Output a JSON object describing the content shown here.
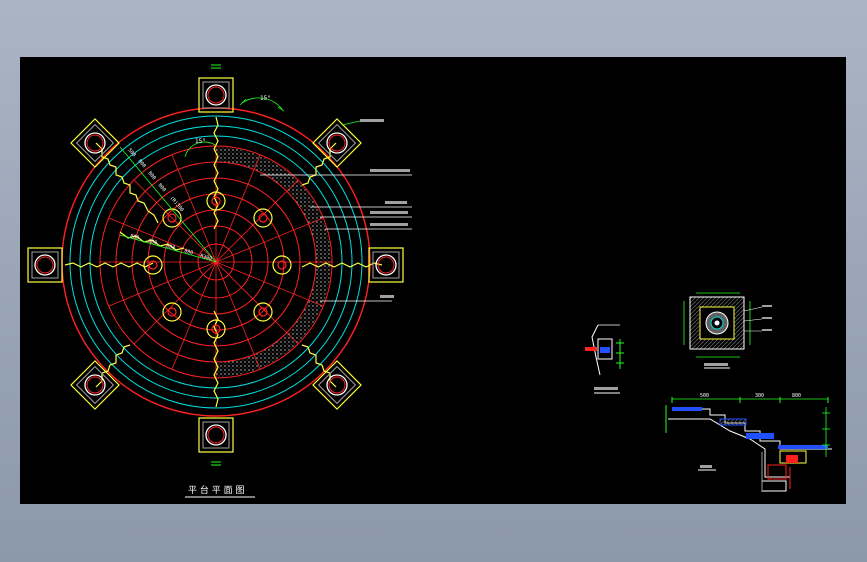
{
  "drawing": {
    "main_plan_title": "平 台 平 面 图",
    "detail_1_label": "detail-a",
    "detail_2_label": "detail-b",
    "section_label": "section",
    "radial_dims_nw": [
      "500",
      "800",
      "800",
      "800",
      "(R)300"
    ],
    "radial_dims_w": [
      "800",
      "800",
      "800",
      "800",
      "R300"
    ],
    "angle_label": "15°",
    "angle_label_2": "15°",
    "section_dims": [
      "500",
      "300",
      "800"
    ]
  },
  "colors": {
    "background": "#000000",
    "red": "#ff2020",
    "cyan": "#00e0e0",
    "yellow": "#ffff40",
    "white": "#ffffff",
    "green": "#20ff20",
    "grey": "#a0a0a0"
  }
}
